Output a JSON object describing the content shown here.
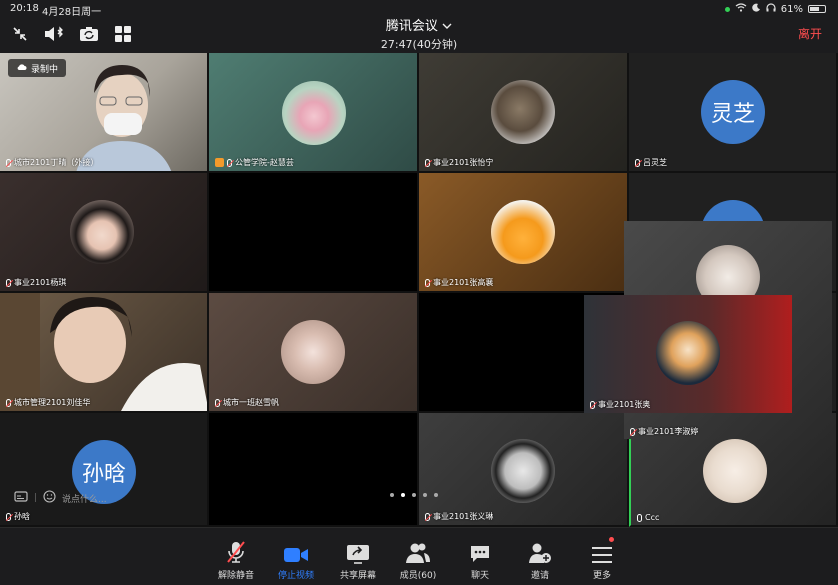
{
  "status": {
    "time": "20:18",
    "date": "4月28日周一",
    "battery": "61%"
  },
  "meeting": {
    "title": "腾讯会议",
    "duration": "27:47(40分钟)",
    "leave": "离开",
    "recording": "录制中"
  },
  "tiles": [
    {
      "name": "城市2101丁晴（外接）",
      "kind": "video-person",
      "muted": true
    },
    {
      "name": "公管学院-赵慧芸",
      "kind": "avatar",
      "muted": true
    },
    {
      "name": "事业2101张怡宁",
      "kind": "avatar",
      "muted": true
    },
    {
      "name": "吕灵芝",
      "kind": "text-avatar",
      "initials": "灵芝",
      "muted": true
    },
    {
      "name": "事业2101杨琪",
      "kind": "avatar",
      "muted": true
    },
    {
      "name": "",
      "kind": "blank",
      "muted": false
    },
    {
      "name": "事业2101张高襄",
      "kind": "avatar",
      "muted": true
    },
    {
      "name": "",
      "kind": "text-avatar-partial",
      "muted": false
    },
    {
      "name": "城市管理2101刘佳华",
      "kind": "video-person",
      "muted": true
    },
    {
      "name": "城市一班赵雪帆",
      "kind": "avatar",
      "muted": true
    },
    {
      "name": "",
      "kind": "blank",
      "muted": false
    },
    {
      "name": "事业2101张奥",
      "kind": "avatar",
      "muted": true
    },
    {
      "name": "孙晗",
      "kind": "text-avatar",
      "initials": "孙晗",
      "muted": true
    },
    {
      "name": "",
      "kind": "blank",
      "muted": false
    },
    {
      "name": "事业2101张义琳",
      "kind": "avatar",
      "muted": true
    },
    {
      "name": "Ccc",
      "kind": "avatar",
      "muted": false
    }
  ],
  "overlay_tile": {
    "name": "事业2101李淑婷"
  },
  "chat": {
    "placeholder": "说点什么..."
  },
  "pager": {
    "count": 5,
    "active": 1
  },
  "toolbar": [
    {
      "label": "解除静音",
      "icon": "mic-off-icon",
      "active": false
    },
    {
      "label": "停止视频",
      "icon": "video-camera-icon",
      "active": true
    },
    {
      "label": "共享屏幕",
      "icon": "share-screen-icon",
      "active": false
    },
    {
      "label": "成员(60)",
      "icon": "members-icon",
      "active": false
    },
    {
      "label": "聊天",
      "icon": "chat-icon",
      "active": false
    },
    {
      "label": "邀请",
      "icon": "invite-icon",
      "active": false
    },
    {
      "label": "更多",
      "icon": "more-icon",
      "active": false
    }
  ],
  "colors": {
    "accent": "#2f7fff",
    "leave": "#ff4d4f",
    "avatar_blue": "#3c79c8",
    "speaking": "#33d056"
  }
}
